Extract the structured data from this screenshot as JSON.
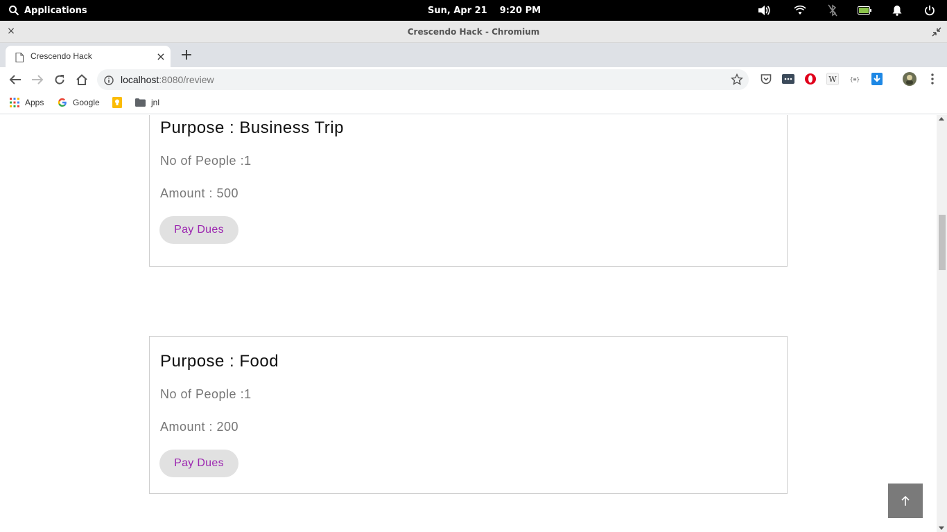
{
  "system_panel": {
    "applications_label": "Applications",
    "date": "Sun, Apr 21",
    "time": "9:20 PM"
  },
  "window": {
    "title": "Crescendo Hack - Chromium",
    "close_glyph": "×"
  },
  "tabs": [
    {
      "title": "Crescendo Hack",
      "close_glyph": "×"
    }
  ],
  "new_tab_glyph": "+",
  "address_bar": {
    "host": "localhost",
    "path": ":8080/review"
  },
  "bookmarks": [
    {
      "label": "Apps",
      "icon": "apps-grid-icon"
    },
    {
      "label": "Google",
      "icon": "google-icon"
    },
    {
      "label": "",
      "icon": "keep-icon"
    },
    {
      "label": "jnl",
      "icon": "folder-icon"
    }
  ],
  "expenses": [
    {
      "purpose": "Purpose : Business Trip",
      "people": "No of People :1",
      "amount": "Amount : 500",
      "button_label": "Pay Dues"
    },
    {
      "purpose": "Purpose : Food",
      "people": "No of People :1",
      "amount": "Amount : 200",
      "button_label": "Pay Dues"
    }
  ],
  "colors": {
    "accent_button_text": "#9c27b0",
    "button_bg": "#e1e1e1",
    "back_to_top_bg": "#7a7a7a"
  }
}
